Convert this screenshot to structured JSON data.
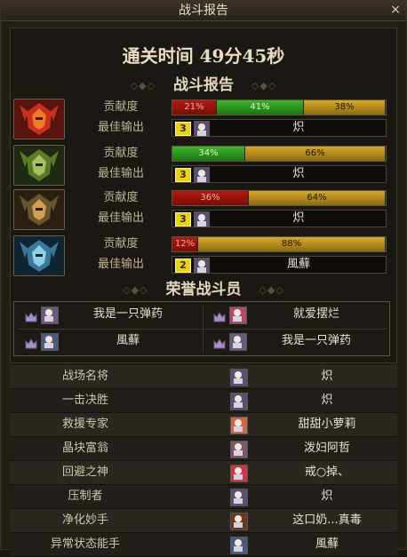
{
  "window": {
    "title": "战斗报告",
    "close_icon": "×"
  },
  "clear_time": {
    "text": "通关时间   49分45秒"
  },
  "report_title": "战斗报告",
  "honor_title": "荣誉战斗员",
  "labels": {
    "contribution": "贡献度",
    "best_output": "最佳输出"
  },
  "players": [
    {
      "segments": [
        {
          "color": "red",
          "pct": 21,
          "label": "21%"
        },
        {
          "color": "green",
          "pct": 41,
          "label": "41%"
        },
        {
          "color": "gold",
          "pct": 38,
          "label": "38%"
        }
      ],
      "best_rank": "3",
      "best_name": "炽"
    },
    {
      "segments": [
        {
          "color": "green",
          "pct": 34,
          "label": "34%"
        },
        {
          "color": "gold",
          "pct": 66,
          "label": "66%"
        }
      ],
      "best_rank": "3",
      "best_name": "炽"
    },
    {
      "segments": [
        {
          "color": "red",
          "pct": 36,
          "label": "36%"
        },
        {
          "color": "gold",
          "pct": 64,
          "label": "64%"
        }
      ],
      "best_rank": "3",
      "best_name": "炽"
    },
    {
      "segments": [
        {
          "color": "red",
          "pct": 12,
          "label": "12%"
        },
        {
          "color": "gold",
          "pct": 88,
          "label": "88%"
        }
      ],
      "best_rank": "2",
      "best_name": "風蘚"
    }
  ],
  "honor": [
    {
      "name": "我是一只弹药"
    },
    {
      "name": "就爱摆烂"
    },
    {
      "name": "風蘚"
    },
    {
      "name": "我是一只弹药"
    }
  ],
  "awards": [
    {
      "title": "战场名将",
      "name": "炽"
    },
    {
      "title": "一击决胜",
      "name": "炽"
    },
    {
      "title": "救援专家",
      "name": "甜甜小萝莉"
    },
    {
      "title": "晶块富翁",
      "name": "泼妇阿哲"
    },
    {
      "title": "回避之神",
      "name": "戒○掉、"
    },
    {
      "title": "压制者",
      "name": "炽"
    },
    {
      "title": "净化妙手",
      "name": "这口奶...真毒"
    },
    {
      "title": "异常状态能手",
      "name": "風蘚"
    }
  ],
  "colors": {
    "red": "#b21a12",
    "green": "#3fb52c",
    "gold": "#d6aa2a",
    "accent_text": "#e3d7bd"
  }
}
